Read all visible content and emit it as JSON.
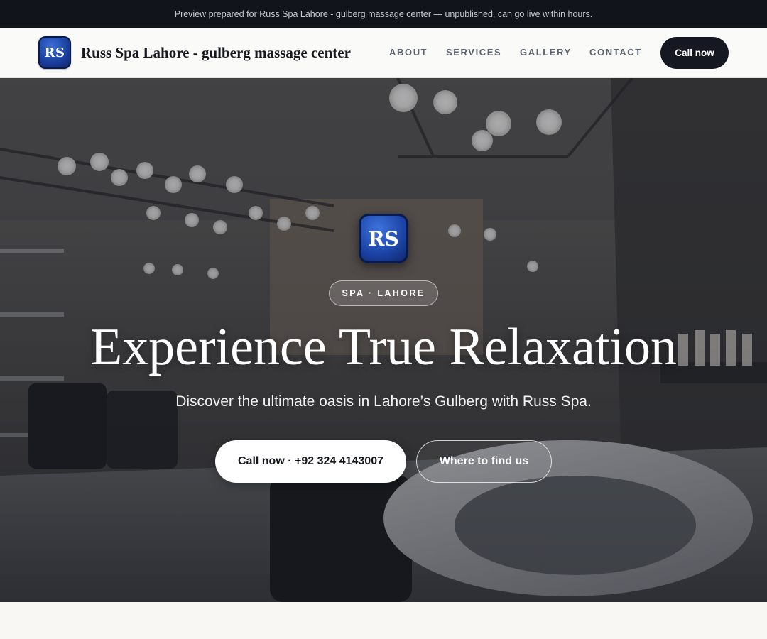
{
  "banner": {
    "text": "Preview prepared for Russ Spa Lahore - gulberg massage center — unpublished, can go live within hours."
  },
  "header": {
    "logo_initials": "RS",
    "brand_name": "Russ Spa Lahore - gulberg massage center",
    "nav": {
      "about": "ABOUT",
      "services": "SERVICES",
      "gallery": "GALLERY",
      "contact": "CONTACT"
    },
    "call_button": "Call now"
  },
  "hero": {
    "logo_initials": "RS",
    "chip": "SPA · LAHORE",
    "title": "Experience True Relaxation",
    "subtitle": "Discover the ultimate oasis in Lahore’s Gulberg with Russ Spa.",
    "primary_button": "Call now · +92 324 4143007",
    "secondary_button": "Where to find us"
  },
  "colors": {
    "banner_bg": "#11141b",
    "accent_dark": "#151820",
    "logo_blue": "#1a3f9e"
  },
  "icons": {
    "logo": "rs-monogram-icon"
  }
}
